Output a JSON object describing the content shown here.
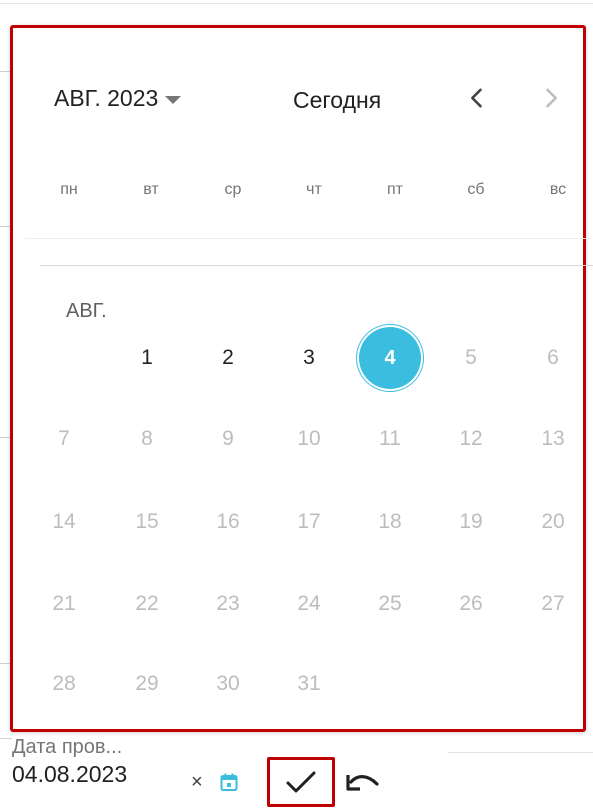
{
  "calendar": {
    "month_selector": "АВГ. 2023",
    "today_button": "Сегодня",
    "weekdays": [
      "пн",
      "вт",
      "ср",
      "чт",
      "пт",
      "сб",
      "вс"
    ],
    "month_label": "АВГ.",
    "days": [
      "1",
      "2",
      "3",
      "4",
      "5",
      "6",
      "7",
      "8",
      "9",
      "10",
      "11",
      "12",
      "13",
      "14",
      "15",
      "16",
      "17",
      "18",
      "19",
      "20",
      "21",
      "22",
      "23",
      "24",
      "25",
      "26",
      "27",
      "28",
      "29",
      "30",
      "31"
    ],
    "selected_day": "4",
    "accent_color": "#3bbde0",
    "highlight_color": "#c00000"
  },
  "field": {
    "label": "Дата пров...",
    "value": "04.08.2023",
    "clear_icon": "×"
  },
  "icons": {
    "prev": "chevron-left-icon",
    "next": "chevron-right-icon",
    "calendar": "calendar-icon",
    "confirm": "check-icon",
    "undo": "undo-icon"
  }
}
